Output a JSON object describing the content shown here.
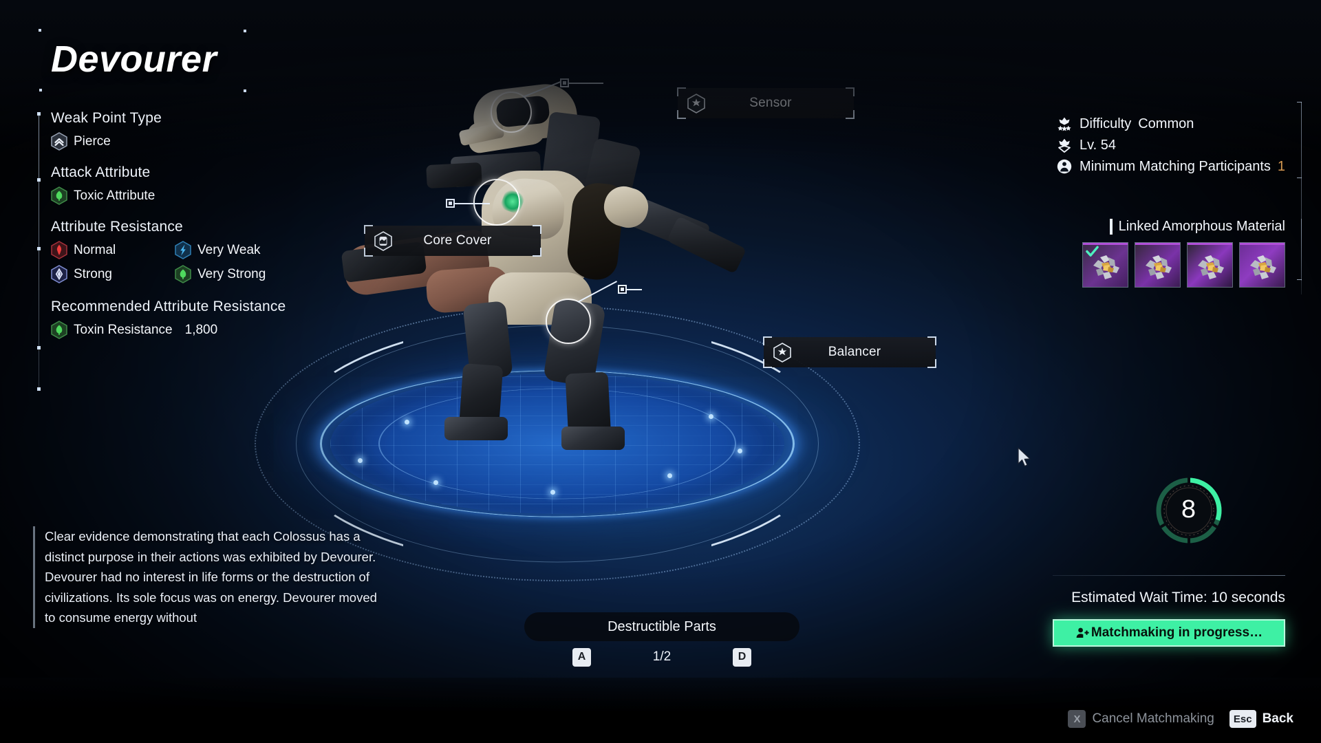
{
  "title": "Devourer",
  "left_panel": {
    "weak_point": {
      "heading": "Weak Point Type",
      "value": "Pierce",
      "icon": "pierce-hex-icon",
      "color": "#8e97a6"
    },
    "attack_attribute": {
      "heading": "Attack Attribute",
      "value": "Toxic Attribute",
      "icon": "toxic-hex-icon",
      "color": "#3fc14e"
    },
    "attribute_resistance": {
      "heading": "Attribute Resistance",
      "items": [
        {
          "label": "Normal",
          "icon": "fire-hex-icon",
          "color": "#e03a3a"
        },
        {
          "label": "Very Weak",
          "icon": "lightning-hex-icon",
          "color": "#3ba3e8"
        },
        {
          "label": "Strong",
          "icon": "chill-hex-icon",
          "color": "#9aa7e0"
        },
        {
          "label": "Very Strong",
          "icon": "toxic-hex-icon",
          "color": "#3fc14e"
        }
      ]
    },
    "recommended_resistance": {
      "heading": "Recommended Attribute Resistance",
      "label": "Toxin Resistance",
      "value": "1,800",
      "icon": "toxic-hex-icon",
      "color": "#3fc14e"
    }
  },
  "part_labels": [
    {
      "name": "Sensor",
      "icon": "star-hex-icon"
    },
    {
      "name": "Core Cover",
      "icon": "core-hex-icon"
    },
    {
      "name": "Balancer",
      "icon": "star-hex-icon"
    }
  ],
  "description": "Clear evidence demonstrating that each Colossus has a distinct purpose in their actions was exhibited by Devourer. Devourer had no interest in life forms or the destruction of civilizations. Its sole focus was on energy. Devourer moved to consume energy without",
  "bottom_nav": {
    "section_title": "Destructible Parts",
    "prev_key": "A",
    "next_key": "D",
    "page": "1/2"
  },
  "right_panel": {
    "stats": [
      {
        "icon": "difficulty-icon",
        "label": "Difficulty",
        "value": "Common",
        "value_color": "#f3f7fc"
      },
      {
        "icon": "level-icon",
        "label": "Lv. 54",
        "value": "",
        "value_color": "#f3f7fc"
      },
      {
        "icon": "participants-icon",
        "label": "Minimum Matching Participants",
        "value": "1",
        "value_color": "#d79a52"
      }
    ],
    "materials": {
      "heading": "Linked Amorphous Material",
      "slots": [
        {
          "name": "amorphous-material-1",
          "selected": true,
          "rarity_color": "#b04fd8"
        },
        {
          "name": "amorphous-material-2",
          "selected": false,
          "rarity_color": "#b04fd8"
        },
        {
          "name": "amorphous-material-3",
          "selected": false,
          "rarity_color": "#b04fd8"
        },
        {
          "name": "amorphous-material-4",
          "selected": false,
          "rarity_color": "#b04fd8"
        }
      ]
    },
    "timer": {
      "value": "8",
      "ring_color": "#3ef0a4",
      "progress": 0.3
    },
    "wait_time": "Estimated Wait Time: 10 seconds",
    "matchmaking_button": {
      "label": "Matchmaking in progress…",
      "icon": "add-person-icon",
      "color": "#3ef0a4"
    }
  },
  "footer": {
    "cancel": {
      "key": "X",
      "label": "Cancel Matchmaking",
      "enabled": false
    },
    "back": {
      "key": "Esc",
      "label": "Back",
      "enabled": true
    }
  }
}
